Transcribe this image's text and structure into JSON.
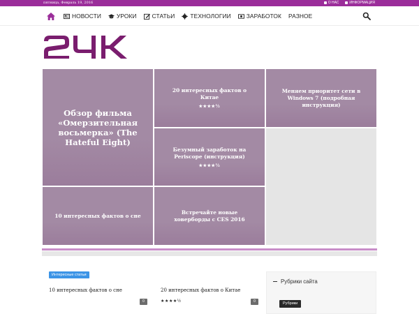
{
  "topbar": {
    "date": "пятница, Февраль 19, 2016",
    "links": [
      "О НАС",
      "ИНФОРМАЦИЯ"
    ]
  },
  "nav": {
    "items": [
      {
        "label": "НОВОСТИ",
        "icon": "newspaper-icon"
      },
      {
        "label": "УРОКИ",
        "icon": "graduation-cap-icon"
      },
      {
        "label": "СТАТЬИ",
        "icon": "edit-icon"
      },
      {
        "label": "ТЕХНОЛОГИИ",
        "icon": "gear-icon"
      },
      {
        "label": "ЗАРАБОТОК",
        "icon": "money-icon"
      },
      {
        "label": "РАЗНОЕ",
        "icon": ""
      }
    ],
    "accent": "#9b2d9a"
  },
  "logo": {
    "text": "24K",
    "color": "#7a1d6e"
  },
  "featured": {
    "big": {
      "title": "Обзор фильма «Омерзительная восьмерка» (The Hateful Eight)"
    },
    "tiles": [
      {
        "title": "20 интересных фактов о Китае",
        "rating": "★★★★½"
      },
      {
        "title": "Меняем приоритет сети в Windows 7 (подробная инструкция)",
        "rating": ""
      },
      {
        "title": "Безумный заработок на Periscope (инструкция)",
        "rating": "★★★★½"
      },
      {
        "title": "10 интересных фактов о сне",
        "rating": ""
      },
      {
        "title": "Встречайте новые ховерборды с CES 2016",
        "rating": ""
      }
    ],
    "tile_color": "#a38aa4"
  },
  "section": {
    "badge": "Интересные статьи",
    "posts": [
      {
        "title": "10 интересных фактов о сне",
        "comments": "0",
        "rating": ""
      },
      {
        "title": "20 интересных фактов о Китае",
        "comments": "0",
        "rating": "★★★★½"
      }
    ]
  },
  "sidebar": {
    "widget_title": "Рубрики сайта",
    "select_label": "Рубрики"
  }
}
